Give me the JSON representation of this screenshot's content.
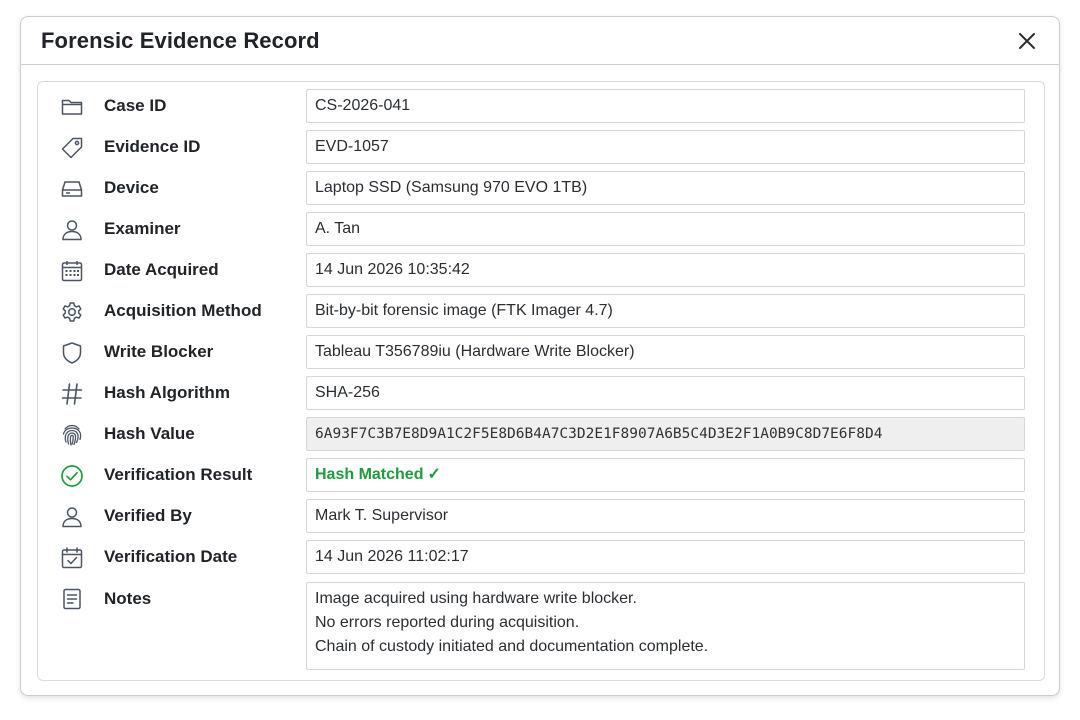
{
  "dialog": {
    "title": "Forensic Evidence Record",
    "close_icon": "close-icon"
  },
  "fields": [
    {
      "icon": "folder-icon",
      "label": "Case ID",
      "value": "CS-2026-041"
    },
    {
      "icon": "tag-icon",
      "label": "Evidence ID",
      "value": "EVD-1057"
    },
    {
      "icon": "hard-drive-icon",
      "label": "Device",
      "value": "Laptop SSD (Samsung 970 EVO 1TB)"
    },
    {
      "icon": "user-icon",
      "label": "Examiner",
      "value": "A. Tan"
    },
    {
      "icon": "calendar-icon",
      "label": "Date Acquired",
      "value": "14 Jun 2026 10:35:42"
    },
    {
      "icon": "gear-icon",
      "label": "Acquisition Method",
      "value": "Bit-by-bit forensic image (FTK Imager 4.7)"
    },
    {
      "icon": "shield-icon",
      "label": "Write Blocker",
      "value": "Tableau T356789iu (Hardware Write Blocker)"
    },
    {
      "icon": "hash-icon",
      "label": "Hash Algorithm",
      "value": "SHA-256"
    },
    {
      "icon": "fingerprint-icon",
      "label": "Hash Value",
      "value": "6A93F7C3B7E8D9A1C2F5E8D6B4A7C3D2E1F8907A6B5C4D3E2F1A0B9C8D7E6F8D4"
    },
    {
      "icon": "check-circle-icon",
      "label": "Verification Result",
      "value": "Hash Matched",
      "check": "✓"
    },
    {
      "icon": "user-icon",
      "label": "Verified By",
      "value": "Mark T. Supervisor"
    },
    {
      "icon": "calendar-check-icon",
      "label": "Verification Date",
      "value": "14 Jun 2026 11:02:17"
    }
  ],
  "notes": {
    "icon": "document-icon",
    "label": "Notes",
    "lines": [
      "Image acquired using hardware write blocker.",
      "No errors reported during acquisition.",
      "Chain of custody initiated and documentation complete."
    ]
  },
  "colors": {
    "success": "#1e9c3c",
    "icon": "#4a5563",
    "readonly_bg": "#efefef"
  }
}
